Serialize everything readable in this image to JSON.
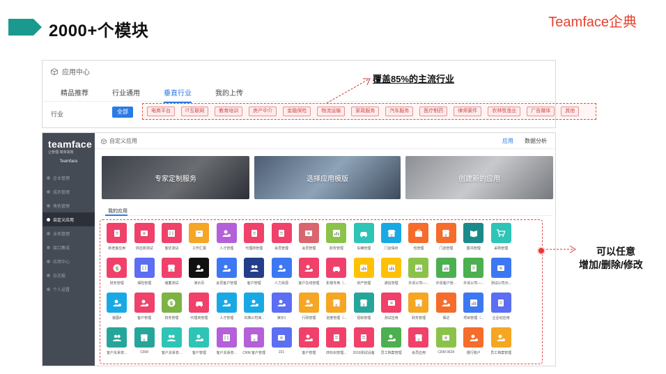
{
  "slide": {
    "title": "2000+个模块",
    "brand": "Teamface企典"
  },
  "app_center": {
    "title": "应用中心",
    "tabs": [
      {
        "label": "精品推荐",
        "active": false
      },
      {
        "label": "行业通用",
        "active": false
      },
      {
        "label": "垂直行业",
        "active": true
      },
      {
        "label": "我的上传",
        "active": false
      }
    ],
    "row_label": "行业",
    "all_label": "全部",
    "industries": [
      "电商平台",
      "IT互联网",
      "教育培训",
      "房产中介",
      "金融保险",
      "物流运输",
      "家政服务",
      "汽车服务",
      "医疗制药",
      "律师案件",
      "农林牧渔业",
      "广告媒体",
      "其他"
    ]
  },
  "annotations": {
    "coverage": "覆盖85%的主流行业",
    "edit_line1": "可以任意",
    "edit_line2": "增加/删除/修改"
  },
  "sidebar": {
    "logo": "teamface",
    "slogan": "让管理·简单高效",
    "org": "Teamface",
    "items": [
      {
        "label": "企业管理",
        "active": false
      },
      {
        "label": "成员管理",
        "active": false
      },
      {
        "label": "角色管理",
        "active": false
      },
      {
        "label": "自定义应用",
        "active": true
      },
      {
        "label": "业务管理",
        "active": false
      },
      {
        "label": "接口集成",
        "active": false
      },
      {
        "label": "应用中心",
        "active": false
      },
      {
        "label": "日志报",
        "active": false
      },
      {
        "label": "个人设置",
        "active": false
      }
    ]
  },
  "main": {
    "breadcrumb": "自定义应用",
    "tabs": [
      {
        "label": "应用",
        "active": true
      },
      {
        "label": "数据分析",
        "active": false
      }
    ],
    "banners": [
      "专家定制服务",
      "选择应用模版",
      "创建新的应用"
    ],
    "my_apps_tab": "我的应用"
  },
  "colors": {
    "accent": "#2a7be4",
    "highlight": "#e04a4a",
    "sidebar": "#454b55"
  },
  "apps": [
    {
      "label": "新老客应用",
      "color": "#f0416b",
      "icon": "doc"
    },
    {
      "label": "供应商测试",
      "color": "#f0416b",
      "icon": "card"
    },
    {
      "label": "客优测试",
      "color": "#f0416b",
      "icon": "grid"
    },
    {
      "label": "工作汇报",
      "color": "#f5a623",
      "icon": "box"
    },
    {
      "label": "人才管理",
      "color": "#b460d9",
      "icon": "user"
    },
    {
      "label": "代理商管理",
      "color": "#f0416b",
      "icon": "doc"
    },
    {
      "label": "会员管理",
      "color": "#f0416b",
      "icon": "doc"
    },
    {
      "label": "会员管理",
      "color": "#d9666e",
      "icon": "card"
    },
    {
      "label": "财务管理",
      "color": "#8bc34a",
      "icon": "chart"
    },
    {
      "label": "车辆管理",
      "color": "#2ec4b6",
      "icon": "car"
    },
    {
      "label": "门店保存",
      "color": "#18a9e4",
      "icon": "shop"
    },
    {
      "label": "包管理",
      "color": "#f56c2b",
      "icon": "bag"
    },
    {
      "label": "门店管理",
      "color": "#f56c2b",
      "icon": "shop"
    },
    {
      "label": "图书管理",
      "color": "#1c8a8a",
      "icon": "book"
    },
    {
      "label": "采购管理",
      "color": "#2ec4b6",
      "icon": "cart"
    },
    {
      "label": "财务管理",
      "color": "#f0416b",
      "icon": "money"
    },
    {
      "label": "保险管理",
      "color": "#5c6ef2",
      "icon": "grid"
    },
    {
      "label": "储蓄测试",
      "color": "#f0416b",
      "icon": "shop"
    },
    {
      "label": "演示页",
      "color": "#111111",
      "icon": "user"
    },
    {
      "label": "会员客户管理",
      "color": "#3d78f2",
      "icon": "user"
    },
    {
      "label": "客户管理",
      "color": "#233f8a",
      "icon": "users"
    },
    {
      "label": "人力资源",
      "color": "#3d78f2",
      "icon": "user"
    },
    {
      "label": "客户在线管理",
      "color": "#f0416b",
      "icon": "user"
    },
    {
      "label": "影楼专用（...",
      "color": "#f0416b",
      "icon": "car"
    },
    {
      "label": "资产管理",
      "color": "#ffc107",
      "icon": "chart"
    },
    {
      "label": "通信管理",
      "color": "#ffc107",
      "icon": "chart"
    },
    {
      "label": "外贸公司—...",
      "color": "#8bc34a",
      "icon": "chart"
    },
    {
      "label": "外贸客户管...",
      "color": "#4caf50",
      "icon": "chart"
    },
    {
      "label": "外贸公司—...",
      "color": "#4caf50",
      "icon": "doc"
    },
    {
      "label": "测试公司示...",
      "color": "#3d78f2",
      "icon": "card"
    },
    {
      "label": "装图A",
      "color": "#18a9e4",
      "icon": "user"
    },
    {
      "label": "客户管理",
      "color": "#f0416b",
      "icon": "user"
    },
    {
      "label": "财务管理",
      "color": "#7cb342",
      "icon": "money"
    },
    {
      "label": "代理商管理",
      "color": "#f0416b",
      "icon": "car"
    },
    {
      "label": "人才管理",
      "color": "#18a9e4",
      "icon": "user"
    },
    {
      "label": "日典公司演...",
      "color": "#18a9e4",
      "icon": "user"
    },
    {
      "label": "演示1",
      "color": "#5c6ef2",
      "icon": "user"
    },
    {
      "label": "行政管理",
      "color": "#f5a623",
      "icon": "user"
    },
    {
      "label": "进度管理（...",
      "color": "#f5a623",
      "icon": "shop"
    },
    {
      "label": "招标管理",
      "color": "#26a69a",
      "icon": "shop"
    },
    {
      "label": "测试应用",
      "color": "#f0416b",
      "icon": "card"
    },
    {
      "label": "财务管理",
      "color": "#f5a623",
      "icon": "shop"
    },
    {
      "label": "保达",
      "color": "#f56c2b",
      "icon": "user"
    },
    {
      "label": "项目管理（...",
      "color": "#3d78f2",
      "icon": "chart"
    },
    {
      "label": "企业动应用",
      "color": "#5c6ef2",
      "icon": "doc"
    },
    {
      "label": "客户关系管...",
      "color": "#26a69a",
      "icon": "users"
    },
    {
      "label": "CRM",
      "color": "#26a69a",
      "icon": "shop"
    },
    {
      "label": "客户关系管...",
      "color": "#2ec4b6",
      "icon": "users"
    },
    {
      "label": "客户管理",
      "color": "#2ec4b6",
      "icon": "user"
    },
    {
      "label": "客户关系管...",
      "color": "#b460d9",
      "icon": "grid"
    },
    {
      "label": "CRM 客户管理",
      "color": "#b460d9",
      "icon": "shop"
    },
    {
      "label": "221",
      "color": "#5c6ef2",
      "icon": "card"
    },
    {
      "label": "客户管理",
      "color": "#f0416b",
      "icon": "user"
    },
    {
      "label": "四份出管理...",
      "color": "#f0416b",
      "icon": "doc"
    },
    {
      "label": "2018测试设备",
      "color": "#f0416b",
      "icon": "doc"
    },
    {
      "label": "员工档案管理",
      "color": "#4caf50",
      "icon": "user"
    },
    {
      "label": "会员应用",
      "color": "#f0416b",
      "icon": "shop"
    },
    {
      "label": "CRM 0624",
      "color": "#8bc34a",
      "icon": "card"
    },
    {
      "label": "银行账户",
      "color": "#f56c2b",
      "icon": "user"
    },
    {
      "label": "员工档案管理",
      "color": "#f5a623",
      "icon": "user"
    }
  ]
}
